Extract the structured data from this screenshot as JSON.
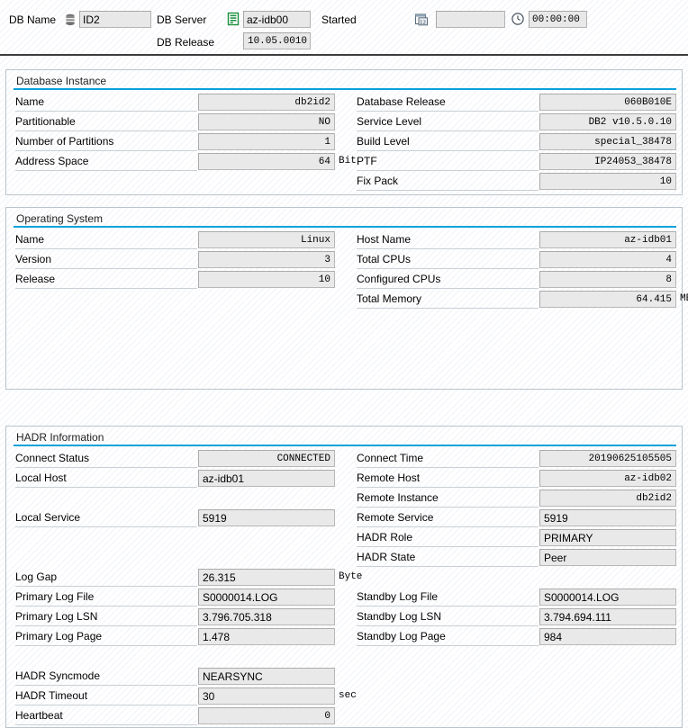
{
  "header": {
    "db_name_label": "DB Name",
    "db_name_icon": "database-icon",
    "db_name_value": "ID2",
    "db_server_label": "DB Server",
    "db_server_icon": "server-icon",
    "db_server_value": "az-idb00",
    "db_release_label": "DB Release",
    "db_release_value": "10.05.0010",
    "started_label": "Started",
    "started_date_icon": "calendar-icon",
    "started_date_value": "",
    "started_time_icon": "clock-icon",
    "started_time_value": "00:00:00"
  },
  "panels": [
    {
      "title": "Database Instance",
      "left_rows": [
        {
          "label": "Name",
          "value": "db2id2",
          "align": "right",
          "unit": ""
        },
        {
          "label": "Partitionable",
          "value": "NO",
          "align": "right",
          "unit": ""
        },
        {
          "label": "Number of Partitions",
          "value": "1",
          "align": "right",
          "unit": ""
        },
        {
          "label": "Address Space",
          "value": "64",
          "align": "right",
          "unit": "Bit"
        }
      ],
      "right_rows": [
        {
          "label": "Database Release",
          "value": "060B010E",
          "align": "right",
          "unit": ""
        },
        {
          "label": "Service Level",
          "value": "DB2 v10.5.0.10",
          "align": "right",
          "unit": ""
        },
        {
          "label": "Build Level",
          "value": "special_38478",
          "align": "right",
          "unit": ""
        },
        {
          "label": "PTF",
          "value": "IP24053_38478",
          "align": "right",
          "unit": ""
        },
        {
          "label": "Fix Pack",
          "value": "10",
          "align": "right",
          "unit": ""
        }
      ]
    },
    {
      "title": "Operating System",
      "left_rows": [
        {
          "label": "Name",
          "value": "Linux",
          "align": "right",
          "unit": ""
        },
        {
          "label": "Version",
          "value": "3",
          "align": "right",
          "unit": ""
        },
        {
          "label": "Release",
          "value": "10",
          "align": "right",
          "unit": ""
        }
      ],
      "right_rows": [
        {
          "label": "Host Name",
          "value": "az-idb01",
          "align": "right",
          "unit": ""
        },
        {
          "label": "Total CPUs",
          "value": "4",
          "align": "right",
          "unit": ""
        },
        {
          "label": "Configured CPUs",
          "value": "8",
          "align": "right",
          "unit": ""
        },
        {
          "label": "Total Memory",
          "value": "64.415",
          "align": "right",
          "unit": "MB"
        }
      ]
    },
    {
      "title": "HADR Information",
      "left_rows": [
        {
          "label": "Connect Status",
          "value": "CONNECTED",
          "align": "right",
          "unit": ""
        },
        {
          "label": "Local Host",
          "value": "az-idb01",
          "align": "left",
          "unit": ""
        },
        {
          "label": "",
          "value": "",
          "align": "left",
          "unit": "",
          "empty": true
        },
        {
          "label": "Local Service",
          "value": "5919",
          "align": "left",
          "unit": ""
        },
        {
          "label": "",
          "value": "",
          "align": "left",
          "unit": "",
          "empty": true
        },
        {
          "label": "",
          "value": "",
          "align": "left",
          "unit": "",
          "empty": true
        },
        {
          "label": "Log Gap",
          "value": "26.315",
          "align": "left",
          "unit": "Byte"
        },
        {
          "label": "Primary Log File",
          "value": "S0000014.LOG",
          "align": "left",
          "unit": ""
        },
        {
          "label": "Primary Log LSN",
          "value": "3.796.705.318",
          "align": "left",
          "unit": ""
        },
        {
          "label": "Primary Log Page",
          "value": "1.478",
          "align": "left",
          "unit": ""
        },
        {
          "label": "",
          "value": "",
          "align": "left",
          "unit": "",
          "empty": true
        },
        {
          "label": "HADR Syncmode",
          "value": "NEARSYNC",
          "align": "left",
          "unit": ""
        },
        {
          "label": "HADR Timeout",
          "value": "30",
          "align": "left",
          "unit": "sec"
        },
        {
          "label": "Heartbeat",
          "value": "0",
          "align": "right",
          "unit": ""
        }
      ],
      "right_rows": [
        {
          "label": "Connect Time",
          "value": "20190625105505",
          "align": "right",
          "unit": ""
        },
        {
          "label": "Remote Host",
          "value": "az-idb02",
          "align": "right",
          "unit": ""
        },
        {
          "label": "Remote Instance",
          "value": "db2id2",
          "align": "right",
          "unit": ""
        },
        {
          "label": "Remote Service",
          "value": "5919",
          "align": "left",
          "unit": ""
        },
        {
          "label": "HADR Role",
          "value": "PRIMARY",
          "align": "left",
          "unit": ""
        },
        {
          "label": "HADR State",
          "value": "Peer",
          "align": "left",
          "unit": ""
        },
        {
          "label": "",
          "value": "",
          "align": "left",
          "unit": "",
          "empty": true
        },
        {
          "label": "Standby Log File",
          "value": "S0000014.LOG",
          "align": "left",
          "unit": ""
        },
        {
          "label": "Standby Log LSN",
          "value": "3.794.694.111",
          "align": "left",
          "unit": ""
        },
        {
          "label": "Standby Log Page",
          "value": "984",
          "align": "left",
          "unit": ""
        }
      ]
    }
  ],
  "colors": {
    "accent": "#0aa2dc",
    "panel_border": "#b9c4cc",
    "field_bg": "#e9e9e9",
    "field_border": "#b7b7b7",
    "header_rule": "#3c3c3c",
    "server_icon_green": "#1a8f3c"
  }
}
